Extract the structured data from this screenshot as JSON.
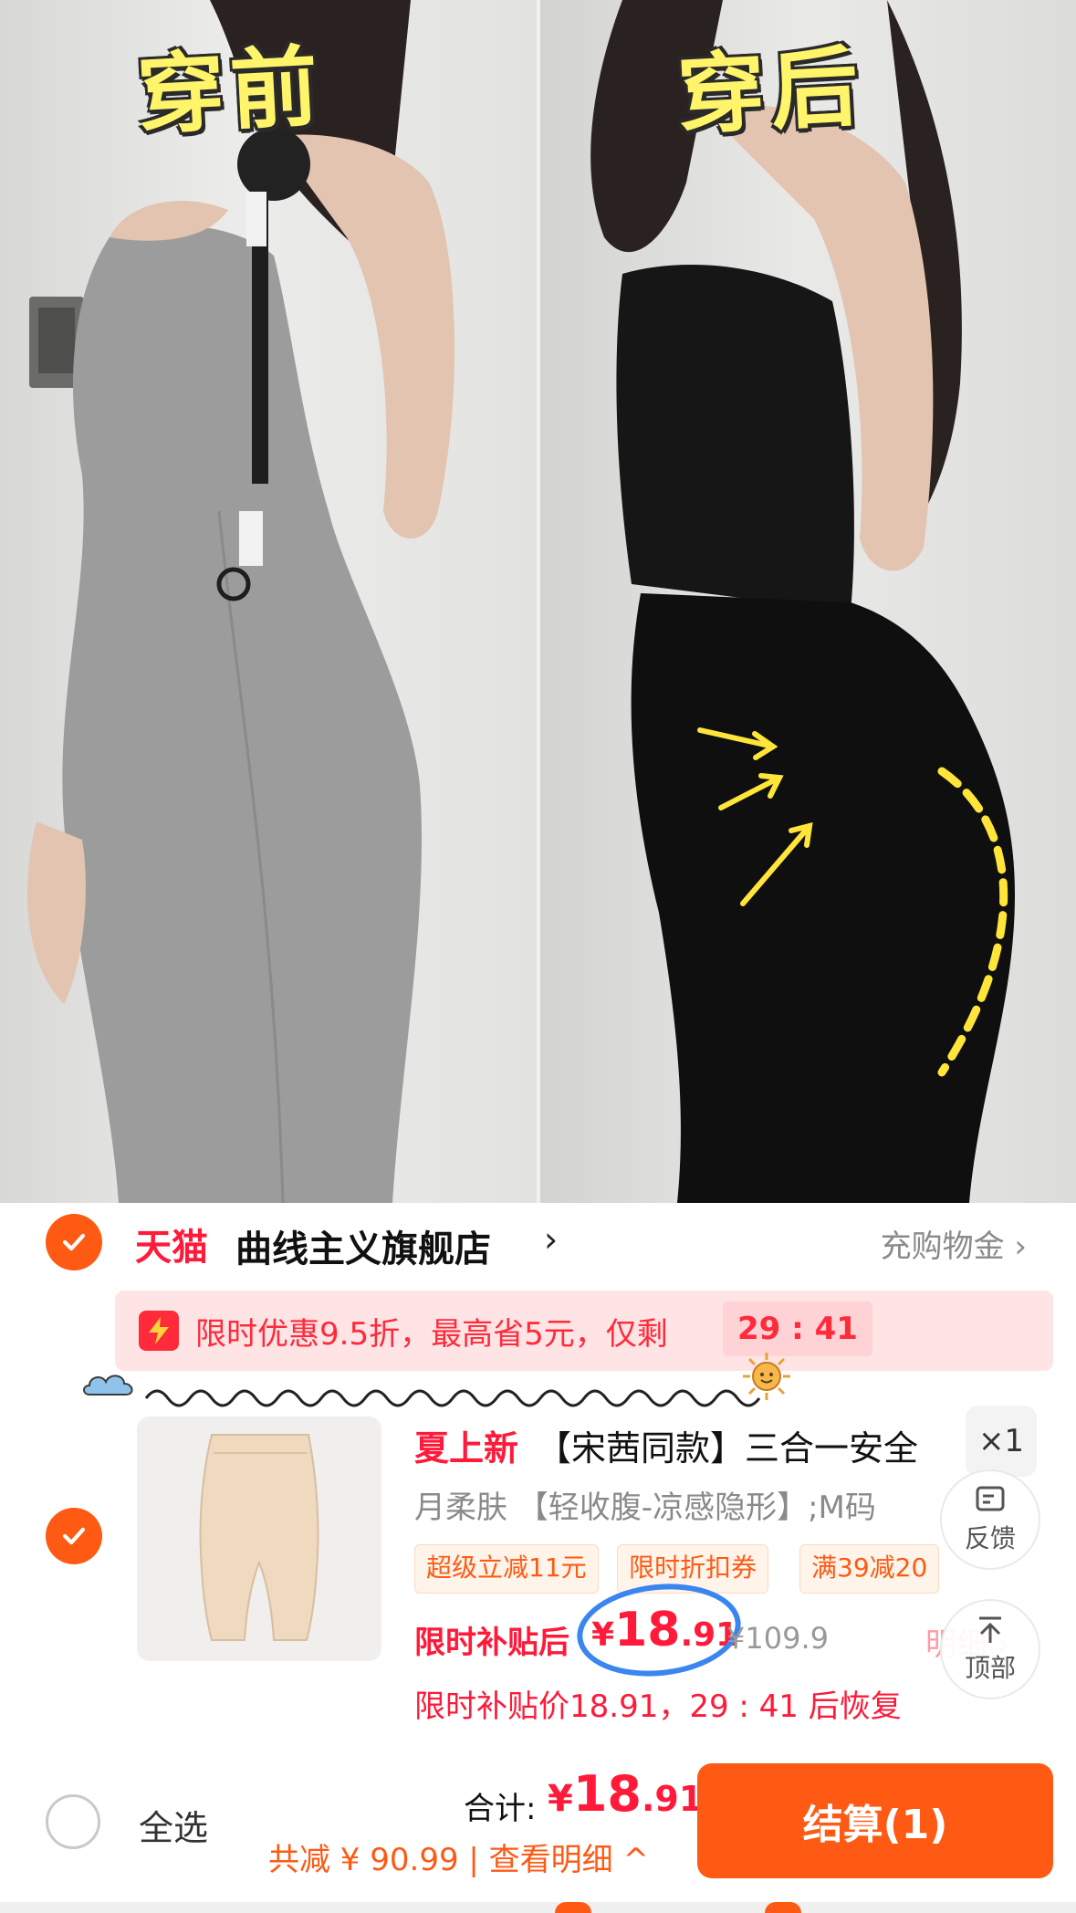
{
  "photo": {
    "caption_before": "穿前",
    "caption_after": "穿后"
  },
  "store": {
    "platform": "天猫",
    "name": "曲线主义旗舰店",
    "chevron": "›",
    "cashback_link": "充购物金 ›"
  },
  "promo": {
    "text": "限时优惠9.5折，最高省5元，仅剩",
    "countdown": "29 : 41"
  },
  "product": {
    "tag": "夏上新",
    "title": "【宋茜同款】三合一安全",
    "quantity": "×1",
    "sku": "月柔肤 【轻收腹-凉感隐形】;M码",
    "coupons": [
      "超级立减11元",
      "限时折扣券",
      "满39减20"
    ],
    "price_label": "限时补贴后",
    "price_currency": "¥",
    "price_integer": "18",
    "price_decimal": ".91",
    "original_price": "¥109.9",
    "details_link": "明细 ›",
    "restore_note": "限时补贴价18.91，29 : 41 后恢复"
  },
  "floating": {
    "feedback_label": "反馈",
    "top_label": "顶部"
  },
  "bottom_bar": {
    "select_all": "全选",
    "total_label": "合计:",
    "total_currency": "¥",
    "total_integer": "18",
    "total_decimal": ".91",
    "saved_text": "共减 ¥ 90.99 | 查看明细 ^",
    "checkout_label": "结算(1)"
  },
  "colors": {
    "accent_orange": "#ff5a14",
    "price_red": "#ff1a3a",
    "promo_bg": "#ffe4e6",
    "annotation_blue": "#3a86f0",
    "caption_yellow": "#fff46a"
  },
  "icons": [
    "check-icon",
    "bolt-icon",
    "cloud-icon",
    "sun-icon",
    "feedback-icon",
    "arrow-up-icon"
  ]
}
